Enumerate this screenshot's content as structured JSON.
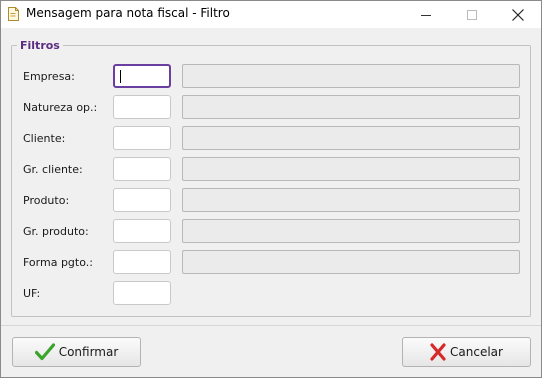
{
  "window": {
    "title": "Mensagem para nota fiscal - Filtro",
    "app_icon": "document-icon",
    "controls": [
      "minimize-icon",
      "maximize-icon",
      "close-icon"
    ]
  },
  "filters": {
    "group_title": "Filtros",
    "rows": [
      {
        "label": "Empresa:",
        "code": "",
        "has_description": true,
        "focused": true
      },
      {
        "label": "Natureza op.:",
        "code": "",
        "has_description": true,
        "focused": false
      },
      {
        "label": "Cliente:",
        "code": "",
        "has_description": true,
        "focused": false
      },
      {
        "label": "Gr. cliente:",
        "code": "",
        "has_description": true,
        "focused": false
      },
      {
        "label": "Produto:",
        "code": "",
        "has_description": true,
        "focused": false
      },
      {
        "label": "Gr. produto:",
        "code": "",
        "has_description": true,
        "focused": false
      },
      {
        "label": "Forma pgto.:",
        "code": "",
        "has_description": true,
        "focused": false
      },
      {
        "label": "UF:",
        "code": "",
        "has_description": false,
        "focused": false
      }
    ]
  },
  "buttons": {
    "confirm_label": "Confirmar",
    "confirm_icon": "checkmark-icon",
    "cancel_label": "Cancelar",
    "cancel_icon": "x-icon"
  },
  "colors": {
    "accent": "#6b3fa0",
    "group_title": "#5a2d82",
    "confirm_icon": "#3aa52a",
    "cancel_icon": "#d42a2a"
  }
}
